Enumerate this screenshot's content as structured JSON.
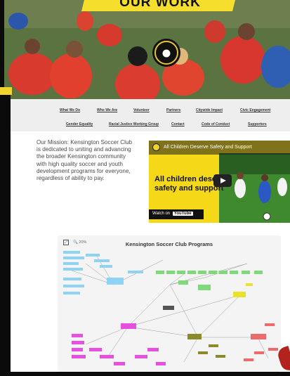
{
  "banner": {
    "title": "OUR WORK"
  },
  "photo": {
    "logo_text": "KENSINGTON",
    "logo_initials": "KSC",
    "logo_bottom": "SOCCER CLUB"
  },
  "nav": {
    "row1": [
      "What We Do",
      "Who We Are",
      "Volunteer",
      "Partners",
      "Citywide Impact",
      "Civic Engagement"
    ],
    "row2": [
      "Gender Equality",
      "Racial Justice Working Group",
      "Contact",
      "Code of Conduct",
      "Supporters"
    ]
  },
  "mission": {
    "text": "Our Mission: Kensington Soccer Club is dedicated to uniting and advancing the broader Kensington community with high quality soccer and youth development programs for everyone, regardless of ability to pay."
  },
  "video": {
    "title": "All Children Deserve Safety and Support",
    "headline": "All children deserve safety and support",
    "watch_on": "Watch on",
    "platform": "YouTube"
  },
  "mindmap": {
    "title": "Kensington Soccer Club Programs",
    "zoom": "20%",
    "colors": {
      "blue": "#8fd3f4",
      "green": "#7fd97a",
      "olive": "#8a8a2a",
      "magenta": "#e64fe0",
      "red": "#ef6a6a",
      "yellow": "#e8e22a"
    }
  }
}
